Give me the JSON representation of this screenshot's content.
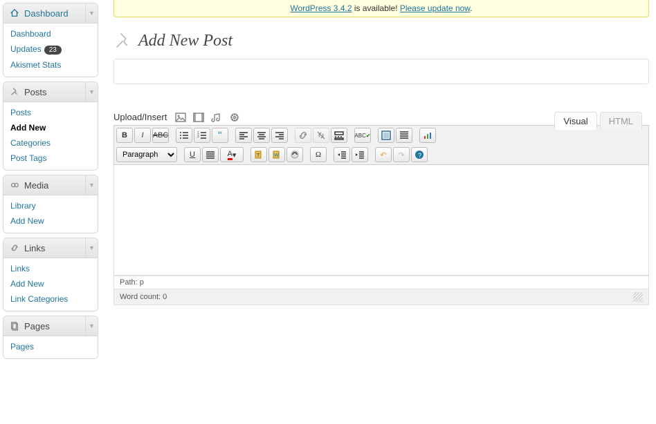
{
  "update_nag": {
    "link": "WordPress 3.4.2",
    "text_middle": " is available! ",
    "action": "Please update now",
    "suffix": "."
  },
  "page_title": "Add New Post",
  "title_placeholder": "",
  "sidebar": {
    "dashboard": {
      "label": "Dashboard",
      "items": [
        "Dashboard",
        "Updates",
        "Akismet Stats"
      ],
      "updates_badge": "23"
    },
    "posts": {
      "label": "Posts",
      "items": [
        "Posts",
        "Add New",
        "Categories",
        "Post Tags"
      ],
      "current": 1
    },
    "media": {
      "label": "Media",
      "items": [
        "Library",
        "Add New"
      ]
    },
    "links": {
      "label": "Links",
      "items": [
        "Links",
        "Add New",
        "Link Categories"
      ]
    },
    "pages": {
      "label": "Pages",
      "items": [
        "Pages"
      ]
    }
  },
  "media_row": {
    "label": "Upload/Insert"
  },
  "tabs": {
    "visual": "Visual",
    "html": "HTML"
  },
  "format_select": "Paragraph",
  "path": "Path: p",
  "word_count": "Word count: 0"
}
